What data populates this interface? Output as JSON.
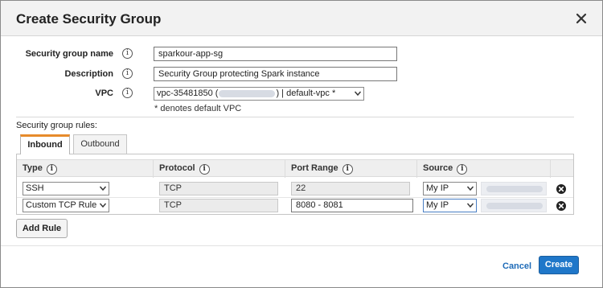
{
  "dialog": {
    "title": "Create Security Group"
  },
  "form": {
    "name_label": "Security group name",
    "name_value": "sparkour-app-sg",
    "description_label": "Description",
    "description_value": "Security Group protecting Spark instance",
    "vpc_label": "VPC",
    "vpc_prefix": "vpc-35481850 (",
    "vpc_suffix": ") | default-vpc *",
    "note": "* denotes default VPC"
  },
  "rules": {
    "section_label": "Security group rules:",
    "tabs": [
      {
        "label": "Inbound",
        "active": true
      },
      {
        "label": "Outbound",
        "active": false
      }
    ],
    "columns": [
      "Type",
      "Protocol",
      "Port Range",
      "Source"
    ],
    "rows": [
      {
        "type": "SSH",
        "protocol": "TCP",
        "port_range": "22",
        "source": "My IP"
      },
      {
        "type": "Custom TCP Rule",
        "protocol": "TCP",
        "port_range": "8080 - 8081",
        "source": "My IP"
      }
    ],
    "add_rule_label": "Add Rule"
  },
  "footer": {
    "cancel_label": "Cancel",
    "create_label": "Create"
  },
  "info_glyph": "i",
  "icons": {
    "close": "close-icon",
    "info": "info-icon",
    "chevron": "chevron-down-icon",
    "delete": "remove-circle-icon"
  },
  "colors": {
    "primary": "#1f77c9",
    "tab_accent": "#e78b2b",
    "link": "#1e6bb8"
  }
}
